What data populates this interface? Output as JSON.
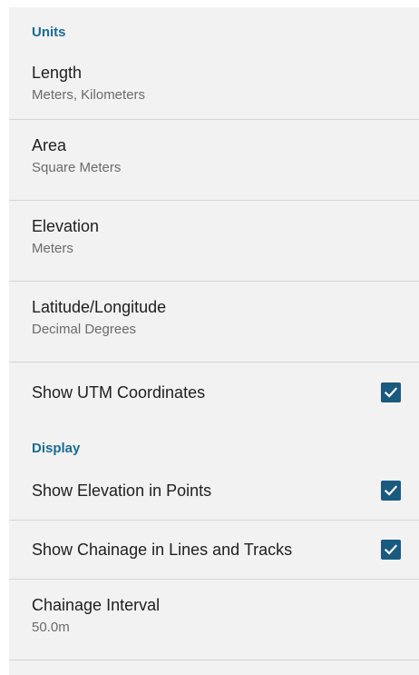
{
  "units": {
    "header": "Units",
    "length": {
      "title": "Length",
      "summary": "Meters, Kilometers"
    },
    "area": {
      "title": "Area",
      "summary": "Square Meters"
    },
    "elevation": {
      "title": "Elevation",
      "summary": "Meters"
    },
    "latlon": {
      "title": "Latitude/Longitude",
      "summary": "Decimal Degrees"
    },
    "show_utm": {
      "title": "Show UTM Coordinates",
      "checked": true
    }
  },
  "display": {
    "header": "Display",
    "show_elevation": {
      "title": "Show Elevation in Points",
      "checked": true
    },
    "show_chainage": {
      "title": "Show Chainage in Lines and Tracks",
      "checked": true
    },
    "chainage_interval": {
      "title": "Chainage Interval",
      "summary": "50.0m"
    }
  },
  "colors": {
    "accent": "#1b6c93",
    "checkbox": "#1b5a7f",
    "background": "#f2f2f2",
    "divider": "#d5d5d5"
  },
  "icons": {
    "checkbox": "checkbox-checked-icon"
  }
}
